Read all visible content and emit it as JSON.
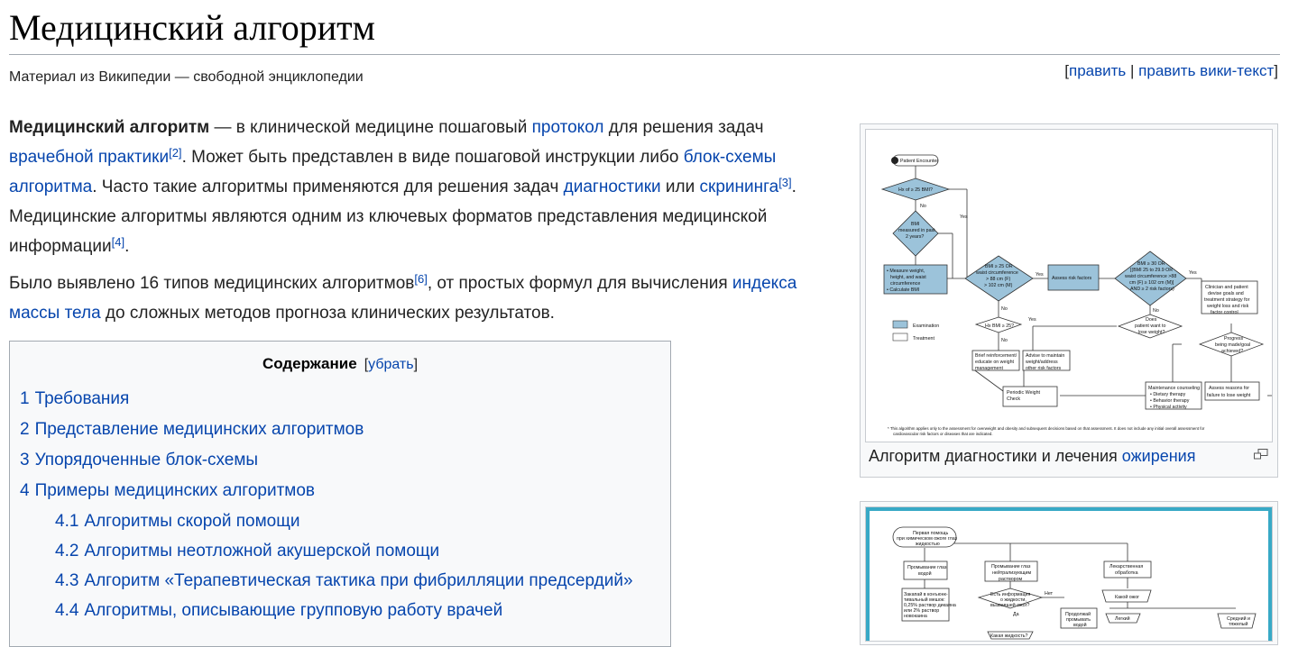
{
  "page": {
    "title": "Медицинский алгоритм",
    "tagline": "Материал из Википедии — свободной энциклопедии",
    "edit": {
      "open": "[",
      "edit_label": "править",
      "sep": " | ",
      "edit_source_label": "править вики-текст",
      "close": "]"
    }
  },
  "intro": {
    "p1": {
      "bold": "Медицинский алгоритм",
      "t1": " — в клинической медицине пошаговый ",
      "l_protocol": "протокол",
      "t2": " для решения задач ",
      "l_practice": "врачебной практики",
      "ref2": "[2]",
      "t3": ". Может быть представлен в виде пошаговой инструкции либо ",
      "l_flowchart": "блок-схемы алгоритма",
      "t4": ". Часто такие алгоритмы применяются для решения задач ",
      "l_diagnostics": "диагностики",
      "t5": " или ",
      "l_screening": "скрининга",
      "ref3": "[3]",
      "t6": ". Медицинские алгоритмы являются одним из ключевых форматов представления медицинской информации",
      "ref4": "[4]",
      "t7": "."
    },
    "p2": {
      "t1": "Было выявлено 16 типов медицинских алгоритмов",
      "ref6": "[6]",
      "t2": ", от простых формул для вычисления ",
      "l_bmi": "индекса массы тела",
      "t3": " до сложных методов прогноза клинических результатов."
    }
  },
  "toc": {
    "title": "Содержание",
    "toggle_open": "[",
    "toggle": "убрать",
    "toggle_close": "]",
    "items": [
      {
        "num": "1",
        "label": "Требования"
      },
      {
        "num": "2",
        "label": "Представление медицинских алгоритмов"
      },
      {
        "num": "3",
        "label": "Упорядоченные блок-схемы"
      },
      {
        "num": "4",
        "label": "Примеры медицинских алгоритмов"
      },
      {
        "num": "4.1",
        "label": "Алгоритмы скорой помощи"
      },
      {
        "num": "4.2",
        "label": "Алгоритмы неотложной акушерской помощи"
      },
      {
        "num": "4.3",
        "label": "Алгоритм «Терапевтическая тактика при фибрилляции предсердий»"
      },
      {
        "num": "4.4",
        "label": "Алгоритмы, описывающие групповую работу врачей"
      }
    ]
  },
  "figure1": {
    "caption_text": "Алгоритм диагностики и лечения ",
    "caption_link": "ожирения",
    "nodes": {
      "patient": "Patient Encounter",
      "hx": "Hx of ≥ 25 BMI?",
      "bmi1": "BMI",
      "bmi2": "measured in past",
      "bmi3": "2 years?",
      "measure1": "• Measure weight,",
      "measure2": "height, and waist",
      "measure3": "circumference",
      "measure4": "• Calculate BMI",
      "d1a": "BMI ≥ 25 OR",
      "d1b": "waist circumference",
      "d1c": "> 88 cm (F)",
      "d1d": "> 102 cm (M)",
      "assess": "Assess risk factors",
      "d2a": "BMI ≥ 30 OR",
      "d2b": "[(BMI 25 to 29.9 OR",
      "d2c": "waist circumference >88",
      "d2d": "cm (F) ≥ 102 cm (M)]",
      "d2e": "AND ≥ 2 risk factors)",
      "clinician1": "Clinician and patient",
      "clinician2": "devise goals and",
      "clinician3": "treatment strategy for",
      "clinician4": "weight loss and risk",
      "clinician5": "factor control",
      "hxbmi": "Hx BMI ≥ 25?",
      "does1": "Does",
      "does2": "patient want to",
      "does3": "lose weight?",
      "progress1": "Progress",
      "progress2": "being made/goal",
      "progress3": "achieved?",
      "brief1": "Brief reinforcement/",
      "brief2": "educate on weight",
      "brief3": "management",
      "advise1": "Advise to maintain",
      "advise2": "weight/address",
      "advise3": "other risk factors",
      "periodic1": "Periodic Weight",
      "periodic2": "Check",
      "maint1": "Maintenance counseling",
      "maint2": "• Dietary therapy",
      "maint3": "• Behavior therapy",
      "maint4": "• Physical activity",
      "reasons1": "Assess reasons for",
      "reasons2": "failure to lose weight",
      "legend_exam": "Examination",
      "legend_treat": "Treatment",
      "yes": "Yes",
      "no": "No",
      "footnote1": "* This algorithm applies only to the assessment for overweight and obesity and subsequent decisions based on that assessment. It does not include any initial overall assessment for",
      "footnote2": "cardiovascular risk factors or diseases that are indicated."
    }
  },
  "figure2": {
    "nodes": {
      "first1": "Первая помощь",
      "first2": "при химическом ожоге глаз",
      "first3": "жидкостью",
      "wash1": "Промывание глаз",
      "wash2": "водой",
      "neut1": "Промывание глаз",
      "neut2": "нейтрализующим",
      "neut3": "раствором",
      "drug1": "Лекарственная",
      "drug2": "обработка",
      "burn1": "Закапай в конъюнк-",
      "burn2": "тивальный мешок:",
      "burn3": "0,25% раствор дикаина",
      "burn4": "или 2% раствор",
      "burn5": "новокаина",
      "info1": "Есть информация",
      "info2": "о жидкости,",
      "info3": "вызвавшей ожог?",
      "net": "Нет",
      "da": "Да",
      "which_burn": "Какой ожог",
      "continue1": "Продолжай",
      "continue2": "промывать",
      "continue3": "водой",
      "light": "Легкий",
      "medium1": "Средний и",
      "medium2": "тяжелый",
      "what_liquid": "Какая жидкость?"
    }
  }
}
